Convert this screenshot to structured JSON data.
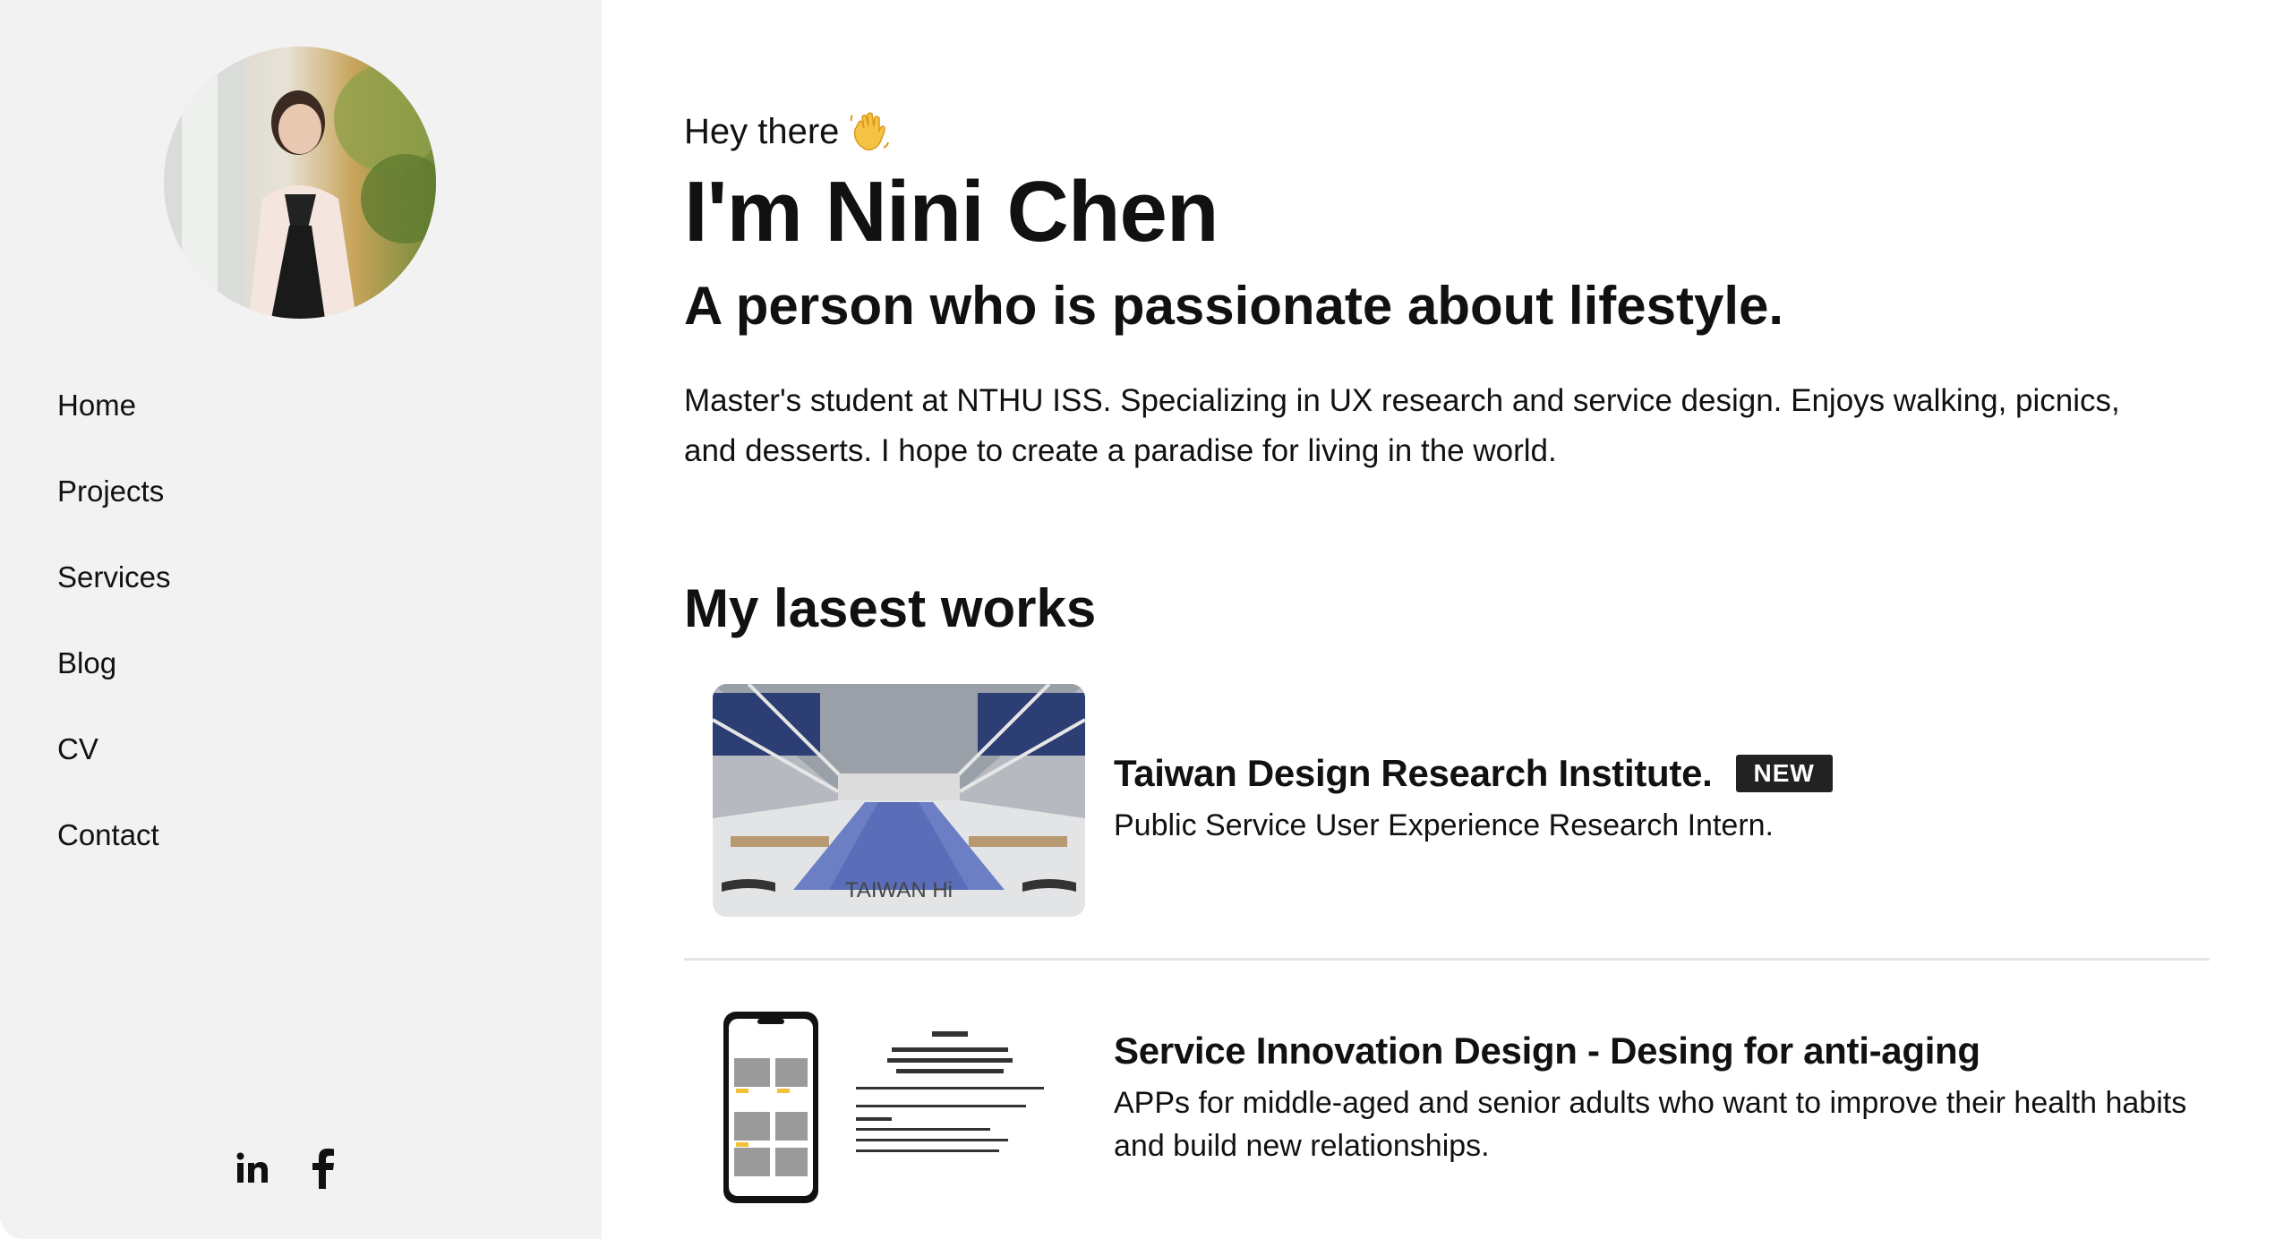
{
  "sidebar": {
    "nav": [
      {
        "label": "Home"
      },
      {
        "label": "Projects"
      },
      {
        "label": "Services"
      },
      {
        "label": "Blog"
      },
      {
        "label": "CV"
      },
      {
        "label": "Contact"
      }
    ],
    "social": [
      {
        "icon": "linkedin-icon",
        "glyph": "in"
      },
      {
        "icon": "facebook-icon",
        "glyph": "f"
      }
    ]
  },
  "hero": {
    "greeting": "Hey there",
    "greeting_icon": "waving-hand-icon",
    "name": "I'm Nini Chen",
    "tagline": "A person who is passionate about lifestyle.",
    "bio": "Master's student at NTHU ISS. Specializing in UX research and service design. Enjoys walking, picnics, and desserts. I hope to create a paradise for living in the world."
  },
  "works": {
    "heading": "My lasest works",
    "items": [
      {
        "title": "Taiwan Design Research Institute.",
        "badge": "NEW",
        "description": "Public Service User Experience Research Intern.",
        "thumb_caption": "TAIWAN Hi"
      },
      {
        "title": "Service Innovation Design - Desing for anti-aging",
        "description": "APPs for middle-aged and senior adults who want to improve their health habits and build new relationships."
      }
    ]
  },
  "colors": {
    "sidebar_bg": "#f2f2f2",
    "badge_bg": "#222222",
    "text": "#111111"
  }
}
